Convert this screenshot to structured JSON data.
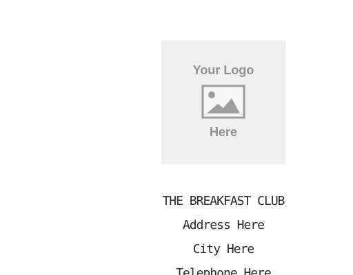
{
  "logo": {
    "top_text": "Your Logo",
    "bottom_text": "Here",
    "icon": "image-placeholder-icon"
  },
  "header_lines": [
    "THE BREAKFAST CLUB",
    "Address Here",
    "City Here",
    "Telephone Here"
  ],
  "colors": {
    "background": "#ffffff",
    "logo_box": "#f0f0f0",
    "logo_text": "#8f8f8f",
    "receipt_text": "#2a2a2a"
  }
}
